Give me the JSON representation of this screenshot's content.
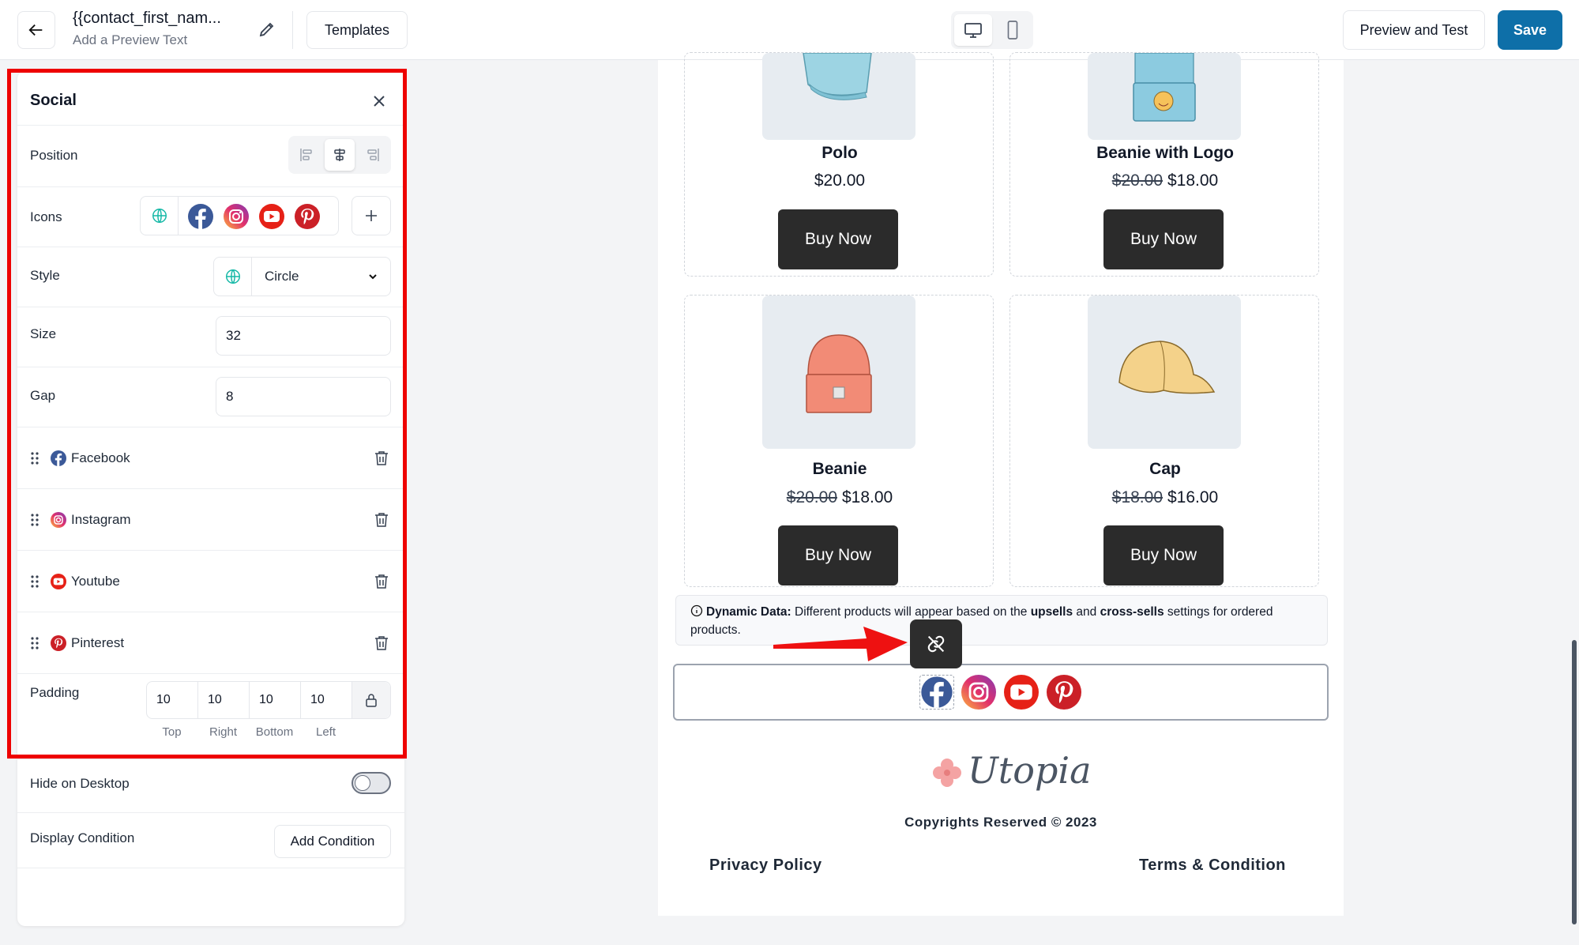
{
  "header": {
    "title": "{{contact_first_nam...",
    "subtitle": "Add a Preview Text",
    "templates_label": "Templates",
    "preview_label": "Preview and Test",
    "save_label": "Save"
  },
  "panel": {
    "title": "Social",
    "position_label": "Position",
    "position_selected": "center",
    "icons_label": "Icons",
    "style_label": "Style",
    "style_value": "Circle",
    "size_label": "Size",
    "size_value": "32",
    "gap_label": "Gap",
    "gap_value": "8",
    "social_items": [
      {
        "label": "Facebook",
        "icon": "facebook-icon"
      },
      {
        "label": "Instagram",
        "icon": "instagram-icon"
      },
      {
        "label": "Youtube",
        "icon": "youtube-icon"
      },
      {
        "label": "Pinterest",
        "icon": "pinterest-icon"
      }
    ],
    "padding_label": "Padding",
    "padding": {
      "top": "10",
      "right": "10",
      "bottom": "10",
      "left": "10"
    },
    "padding_labels": {
      "top": "Top",
      "right": "Right",
      "bottom": "Bottom",
      "left": "Left"
    },
    "hide_label": "Hide on Desktop",
    "hide_on_desktop": false,
    "condition_label": "Display Condition",
    "add_condition_label": "Add Condition"
  },
  "canvas": {
    "products": [
      {
        "name": "Polo",
        "price": "$20.00",
        "old_price": "",
        "button": "Buy Now"
      },
      {
        "name": "Beanie with Logo",
        "price": "$18.00",
        "old_price": "$20.00",
        "button": "Buy Now"
      },
      {
        "name": "Beanie",
        "price": "$18.00",
        "old_price": "$20.00",
        "button": "Buy Now"
      },
      {
        "name": "Cap",
        "price": "$16.00",
        "old_price": "$18.00",
        "button": "Buy Now"
      }
    ],
    "info": {
      "prefix": "Dynamic Data:",
      "text1": " Different products will appear based on the ",
      "bold1": "upsells",
      "text2": " and ",
      "bold2": "cross-sells",
      "text3": " settings for ordered products."
    },
    "logo_text": "Utopia",
    "copyright": "Copyrights Reserved © 2023",
    "privacy": "Privacy Policy",
    "terms": "Terms & Condition"
  },
  "colors": {
    "accent": "#0e6fa8",
    "highlight": "#ee0000",
    "facebook": "#3b5998",
    "youtube": "#e62117",
    "pinterest": "#cb2027",
    "button_dark": "#2b2b2b"
  }
}
